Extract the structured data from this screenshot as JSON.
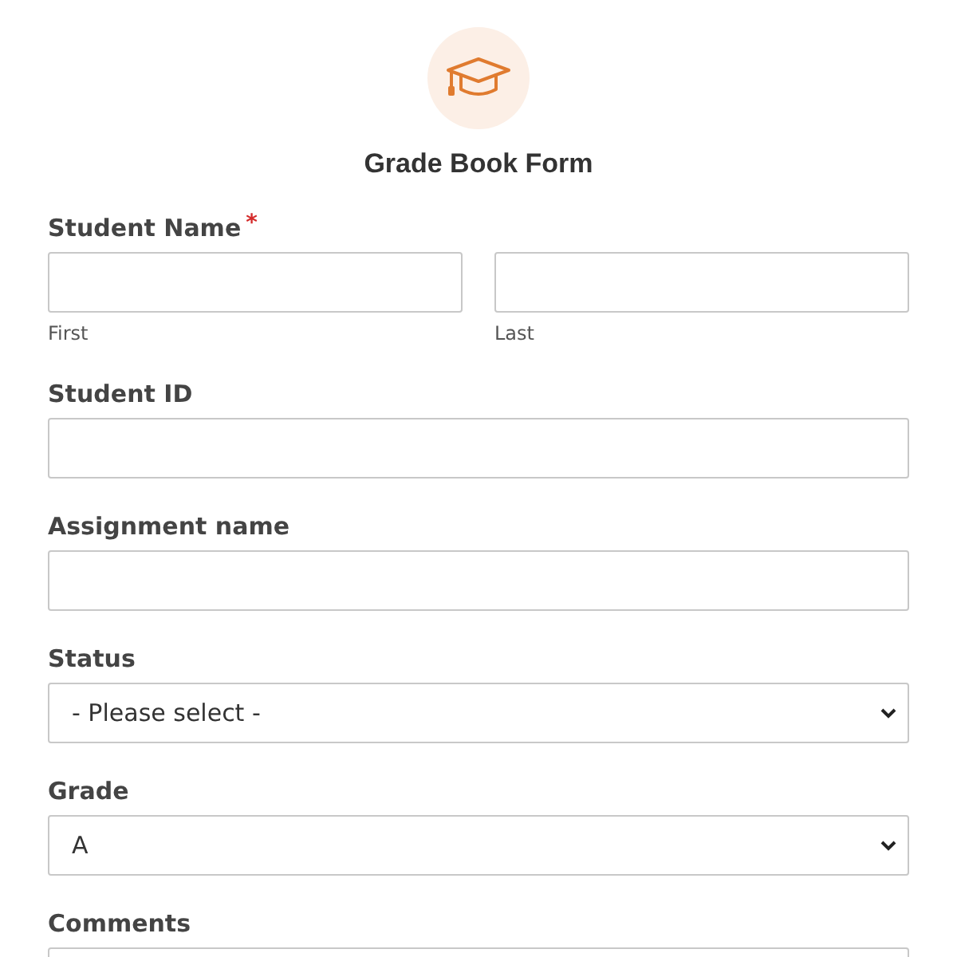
{
  "form": {
    "title": "Grade Book Form"
  },
  "fields": [
    {
      "kind": "name",
      "label": "Student Name",
      "required_mark": "*",
      "parts": [
        {
          "sublabel": "First"
        },
        {
          "sublabel": "Last"
        }
      ]
    },
    {
      "kind": "text",
      "label": "Student ID"
    },
    {
      "kind": "text",
      "label": "Assignment name"
    },
    {
      "kind": "select",
      "label": "Status",
      "value": "- Please select -"
    },
    {
      "kind": "select",
      "label": "Grade",
      "value": "A"
    },
    {
      "kind": "textarea",
      "label": "Comments"
    }
  ]
}
